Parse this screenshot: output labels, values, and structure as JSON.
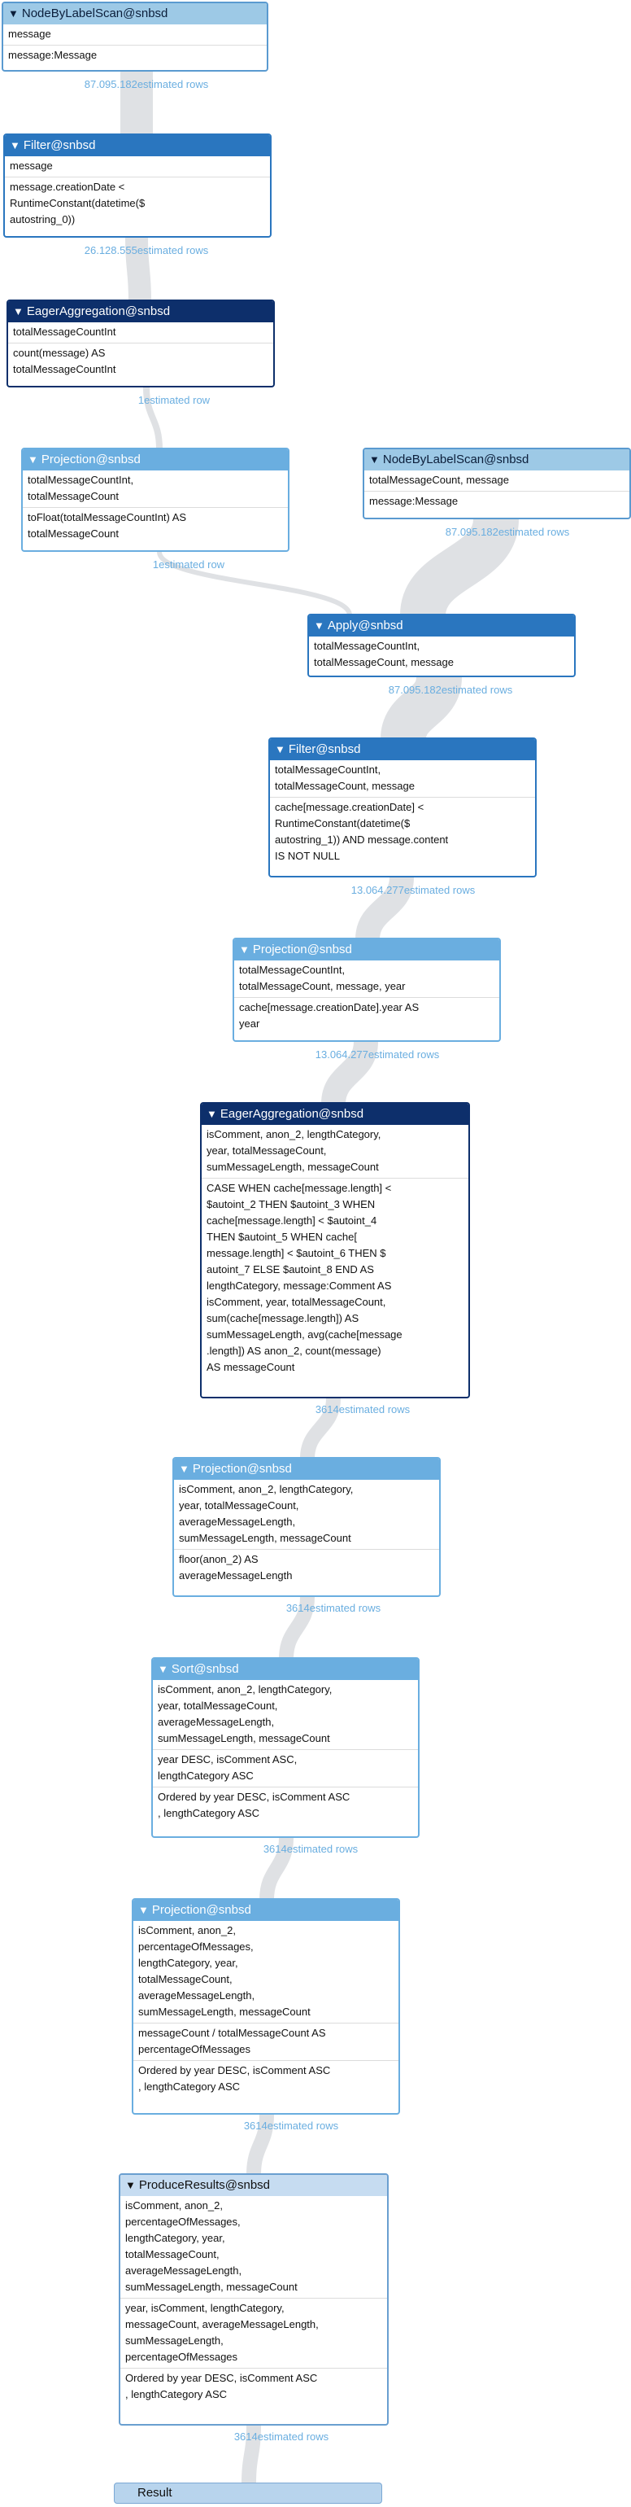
{
  "nodes": [
    {
      "title": "NodeByLabelScan@snbsd",
      "color": "#9dc9e6",
      "sections": [
        "message",
        "message:Message"
      ],
      "estimate": "87.095.182estimated rows"
    },
    {
      "title": "Filter@snbsd",
      "color": "#2a76bf",
      "sections": [
        "message",
        "message.creationDate <\nRuntimeConstant(datetime($\nautostring_0))"
      ],
      "estimate": "26.128.555estimated rows"
    },
    {
      "title": "EagerAggregation@snbsd",
      "color": "#0d2f6b",
      "sections": [
        "totalMessageCountInt",
        "count(message) AS\ntotalMessageCountInt"
      ],
      "estimate": "1estimated row"
    },
    {
      "title": "Projection@snbsd",
      "color": "#6aaee0",
      "sections": [
        "totalMessageCountInt,\ntotalMessageCount",
        "toFloat(totalMessageCountInt) AS\ntotalMessageCount"
      ],
      "estimate": "1estimated row"
    },
    {
      "title": "NodeByLabelScan@snbsd",
      "color": "#9dc9e6",
      "sections": [
        "totalMessageCount, message",
        "message:Message"
      ],
      "estimate": "87.095.182estimated rows"
    },
    {
      "title": "Apply@snbsd",
      "color": "#2a76bf",
      "sections": [
        "totalMessageCountInt,\ntotalMessageCount, message"
      ],
      "estimate": "87.095.182estimated rows"
    },
    {
      "title": "Filter@snbsd",
      "color": "#2a76bf",
      "sections": [
        "totalMessageCountInt,\ntotalMessageCount, message",
        "cache[message.creationDate] <\nRuntimeConstant(datetime($\nautostring_1)) AND message.content\nIS NOT NULL"
      ],
      "estimate": "13.064.277estimated rows"
    },
    {
      "title": "Projection@snbsd",
      "color": "#6aaee0",
      "sections": [
        "totalMessageCountInt,\ntotalMessageCount, message, year",
        "cache[message.creationDate].year AS\nyear"
      ],
      "estimate": "13.064.277estimated rows"
    },
    {
      "title": "EagerAggregation@snbsd",
      "color": "#0d2f6b",
      "sections": [
        "isComment, anon_2, lengthCategory,\nyear, totalMessageCount,\nsumMessageLength, messageCount",
        "CASE WHEN cache[message.length] <\n$autoint_2 THEN $autoint_3 WHEN\ncache[message.length] < $autoint_4\nTHEN $autoint_5 WHEN cache[\nmessage.length] < $autoint_6 THEN $\nautoint_7 ELSE $autoint_8 END AS\nlengthCategory, message:Comment AS\nisComment, year, totalMessageCount,\nsum(cache[message.length]) AS\nsumMessageLength, avg(cache[message\n.length]) AS anon_2, count(message)\nAS messageCount"
      ],
      "estimate": "3614estimated rows"
    },
    {
      "title": "Projection@snbsd",
      "color": "#6aaee0",
      "sections": [
        "isComment, anon_2, lengthCategory,\nyear, totalMessageCount,\naverageMessageLength,\nsumMessageLength, messageCount",
        "floor(anon_2) AS\naverageMessageLength"
      ],
      "estimate": "3614estimated rows"
    },
    {
      "title": "Sort@snbsd",
      "color": "#6aaee0",
      "sections": [
        "isComment, anon_2, lengthCategory,\nyear, totalMessageCount,\naverageMessageLength,\nsumMessageLength, messageCount",
        "year DESC, isComment ASC,\nlengthCategory ASC",
        "Ordered by year DESC, isComment ASC\n, lengthCategory ASC"
      ],
      "estimate": "3614estimated rows"
    },
    {
      "title": "Projection@snbsd",
      "color": "#6aaee0",
      "sections": [
        "isComment, anon_2,\npercentageOfMessages,\nlengthCategory, year,\ntotalMessageCount,\naverageMessageLength,\nsumMessageLength, messageCount",
        "messageCount / totalMessageCount AS\npercentageOfMessages",
        "Ordered by year DESC, isComment ASC\n, lengthCategory ASC"
      ],
      "estimate": "3614estimated rows"
    },
    {
      "title": "ProduceResults@snbsd",
      "color": "#c6dcf1",
      "dark_text": true,
      "sections": [
        "isComment, anon_2,\npercentageOfMessages,\nlengthCategory, year,\ntotalMessageCount,\naverageMessageLength,\nsumMessageLength, messageCount",
        "year, isComment, lengthCategory,\nmessageCount, averageMessageLength,\nsumMessageLength,\npercentageOfMessages",
        "Ordered by year DESC, isComment ASC\n, lengthCategory ASC"
      ],
      "estimate": "3614estimated rows"
    }
  ],
  "result": {
    "label": "Result"
  }
}
